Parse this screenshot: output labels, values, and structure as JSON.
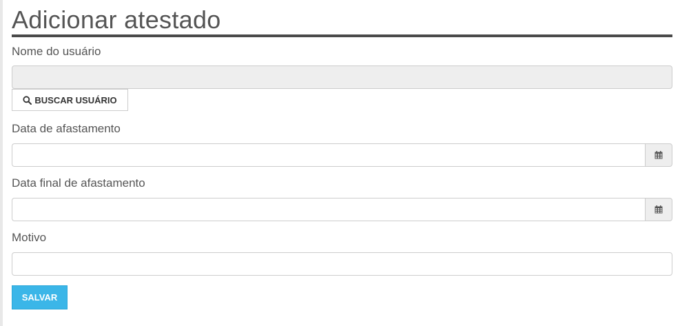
{
  "page": {
    "title": "Adicionar atestado"
  },
  "form": {
    "user_name": {
      "label": "Nome do usuário",
      "value": "",
      "placeholder": ""
    },
    "search_user_button": {
      "label": "BUSCAR USUÁRIO",
      "icon": "search-icon"
    },
    "leave_date": {
      "label": "Data de afastamento",
      "value": "",
      "icon": "calendar-icon"
    },
    "leave_end_date": {
      "label": "Data final de afastamento",
      "value": "",
      "icon": "calendar-icon"
    },
    "reason": {
      "label": "Motivo",
      "value": ""
    },
    "save_button": {
      "label": "SALVAR"
    }
  },
  "colors": {
    "accent": "#3bb6e8",
    "title_rule": "#4a4a4a",
    "readonly_bg": "#eeeeee"
  }
}
